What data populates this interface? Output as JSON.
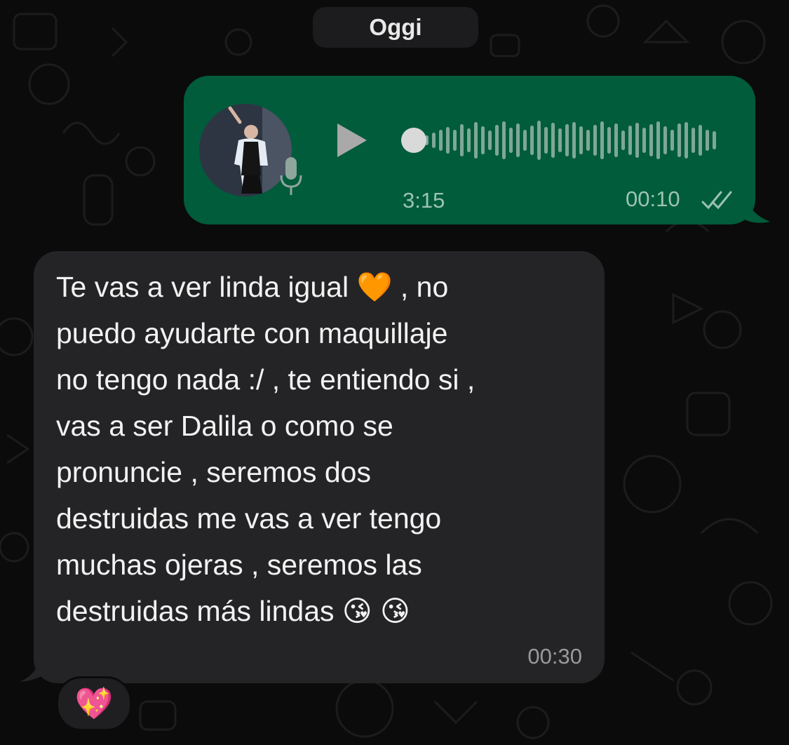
{
  "chat": {
    "date_separator": "Oggi",
    "voice_message": {
      "duration": "3:15",
      "time": "00:10",
      "status_icon": "double-check-icon",
      "progress": 0.0,
      "play_icon": "play-icon",
      "mic_icon": "microphone-icon"
    },
    "text_message": {
      "text": "Te vas a ver linda igual 🧡 , no\npuedo ayudarte con maquillaje\nno tengo nada :/  , te entiendo si ,\nvas a ser Dalila o como se\npronuncie , seremos dos\ndestruidas me vas a ver tengo\nmuchas ojeras , seremos las\ndestruidas más lindas 😘  😘",
      "time": "00:30"
    },
    "reaction": "💖"
  },
  "colors": {
    "outgoing_bubble": "#005c3b",
    "incoming_bubble": "#242426",
    "background": "#0b0b0b"
  }
}
